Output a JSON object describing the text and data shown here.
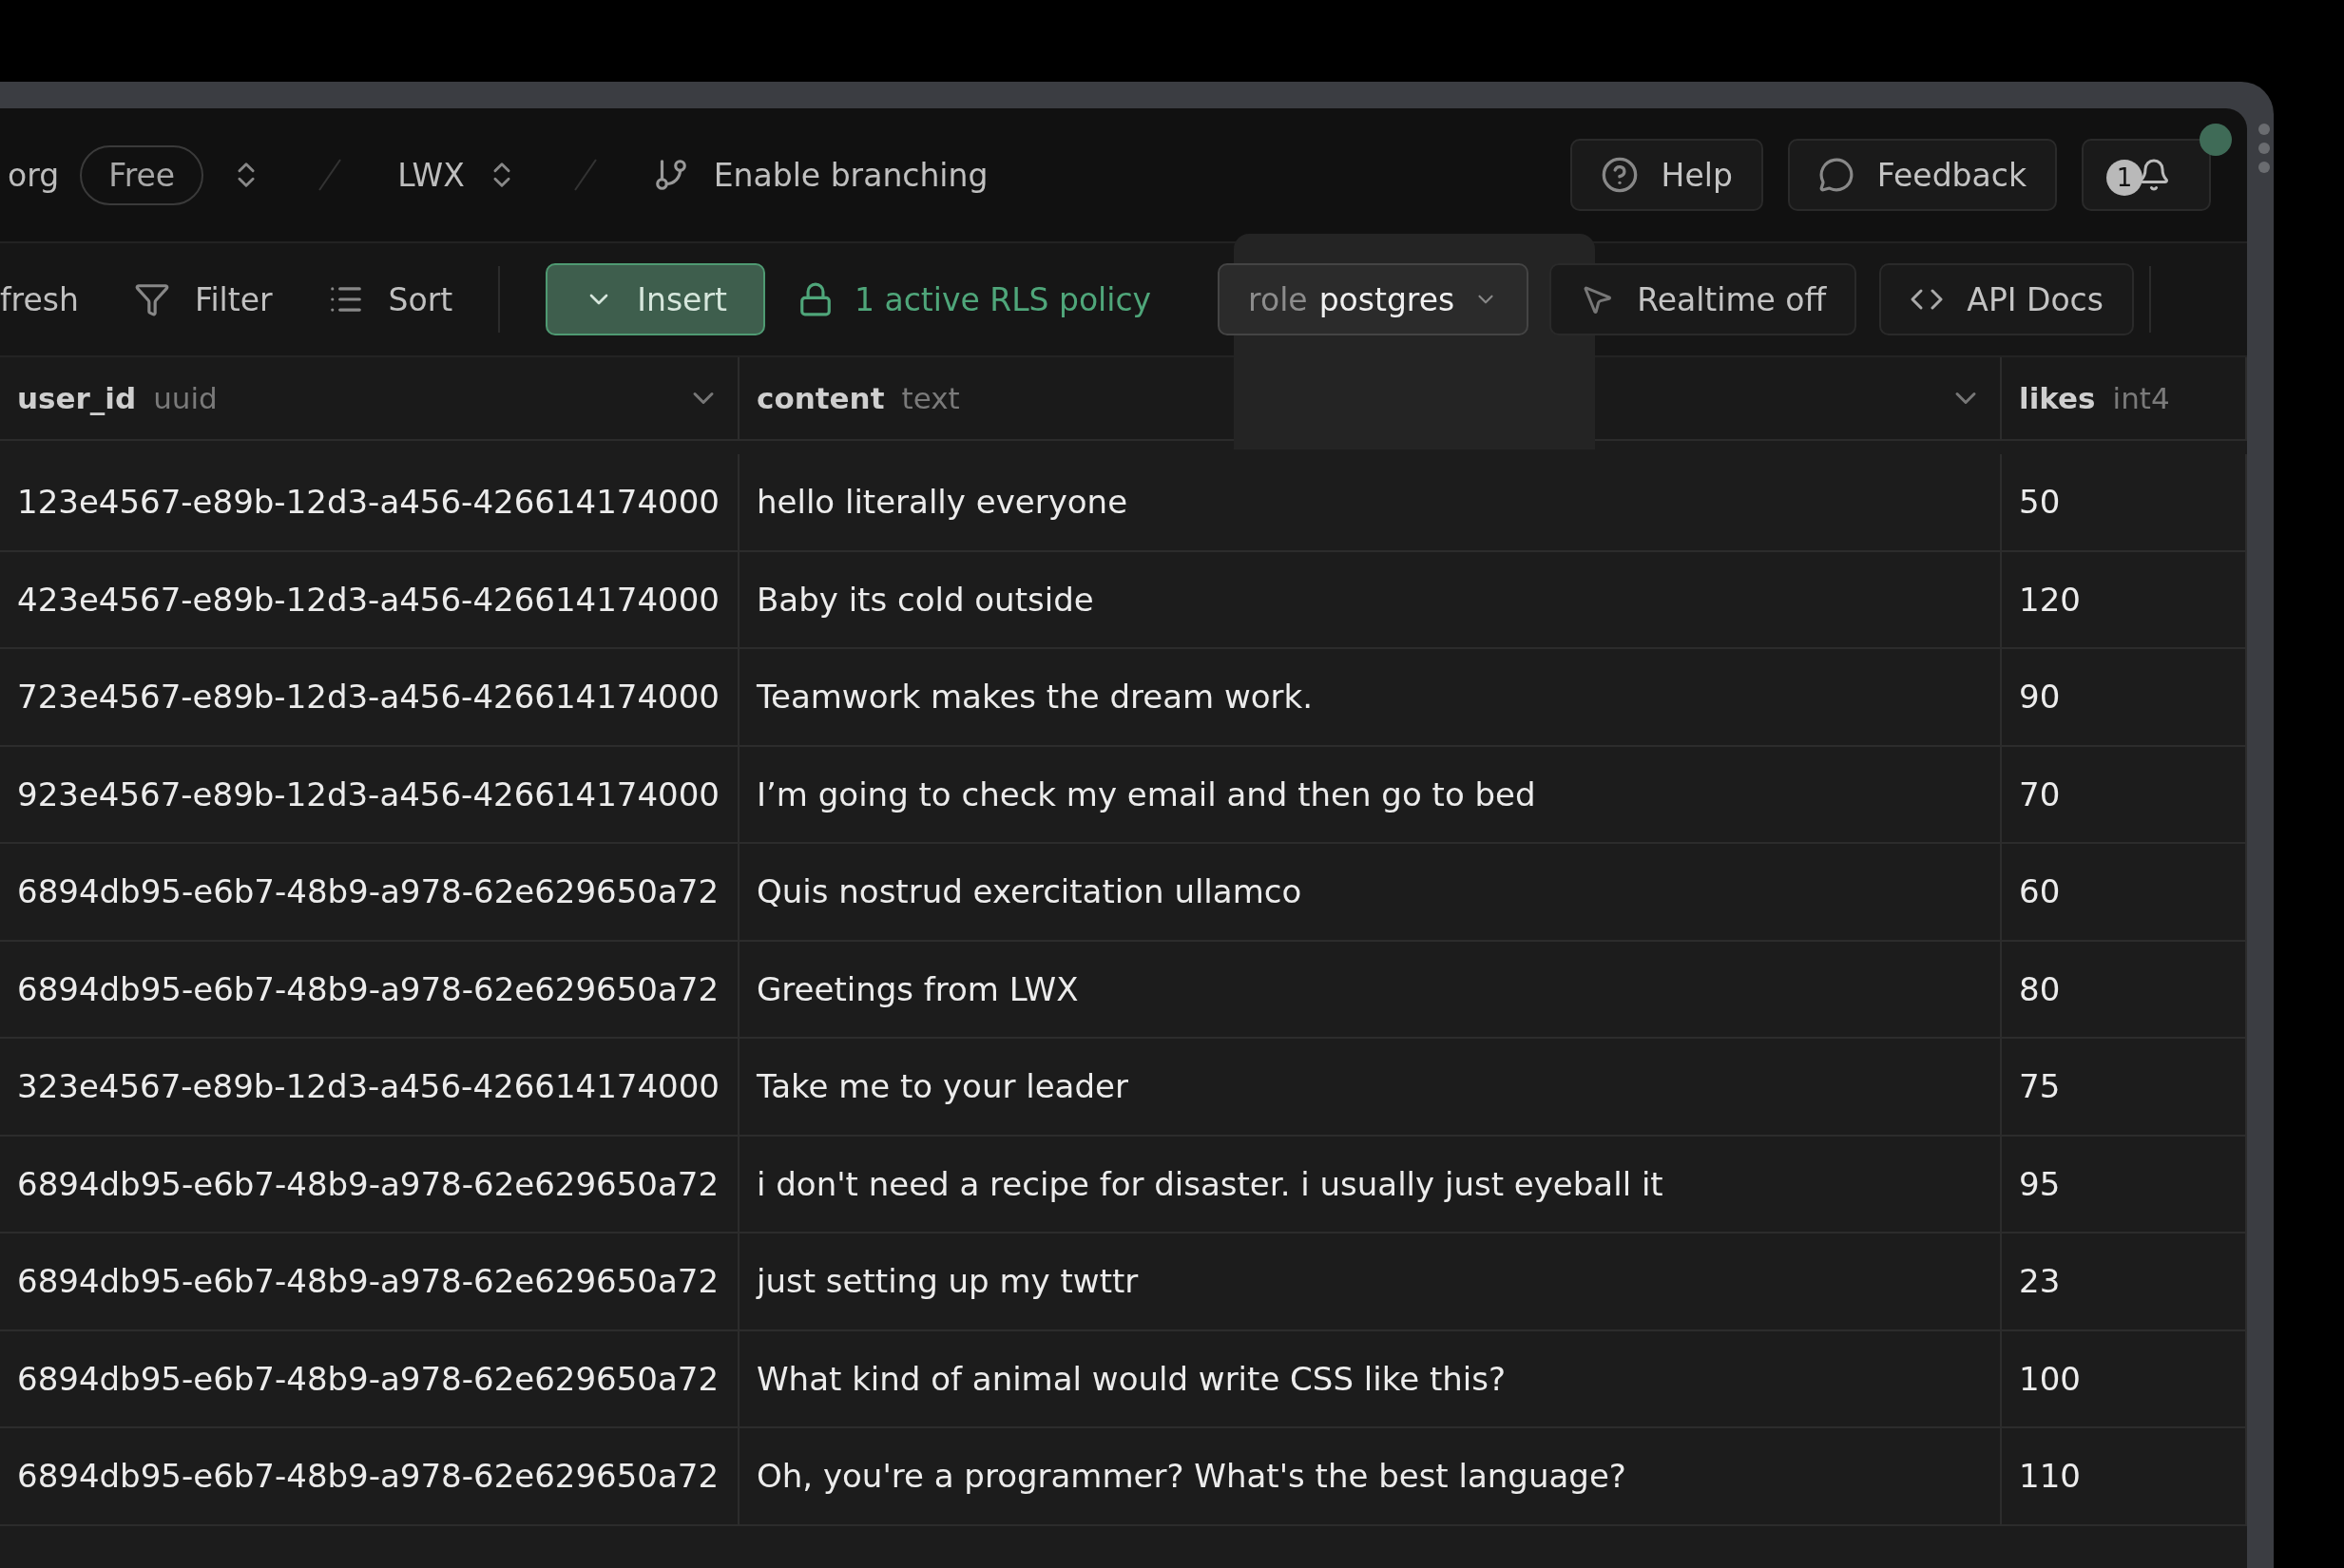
{
  "top_bar": {
    "org": "org",
    "plan": "Free",
    "project": "LWX",
    "branching": "Enable branching",
    "help": "Help",
    "feedback": "Feedback",
    "notifications": "1",
    "online": true
  },
  "toolbar": {
    "refresh": "fresh",
    "filter": "Filter",
    "sort": "Sort",
    "insert": "Insert",
    "rls_policy": "1 active RLS policy",
    "role_label": "role",
    "role": "postgres",
    "role_menu_open": true,
    "realtime": "Realtime off",
    "api_docs": "API Docs"
  },
  "table": {
    "columns": [
      {
        "name": "user_id",
        "type": "uuid",
        "menu": true
      },
      {
        "name": "content",
        "type": "text",
        "menu": true
      },
      {
        "name": "likes",
        "type": "int4",
        "menu": false
      }
    ],
    "rows": [
      [
        "123e4567-e89b-12d3-a456-426614174000",
        "hello literally everyone",
        "50"
      ],
      [
        "423e4567-e89b-12d3-a456-426614174000",
        "Baby its cold outside",
        "120"
      ],
      [
        "723e4567-e89b-12d3-a456-426614174000",
        "Teamwork makes the dream work.",
        "90"
      ],
      [
        "923e4567-e89b-12d3-a456-426614174000",
        "I’m going to check my email and then go to bed",
        "70"
      ],
      [
        "6894db95-e6b7-48b9-a978-62e629650a72",
        "Quis nostrud exercitation ullamco",
        "60"
      ],
      [
        "6894db95-e6b7-48b9-a978-62e629650a72",
        "Greetings from LWX",
        "80"
      ],
      [
        "323e4567-e89b-12d3-a456-426614174000",
        "Take me to your leader",
        "75"
      ],
      [
        "6894db95-e6b7-48b9-a978-62e629650a72",
        "i don't need a recipe for disaster. i usually just eyeball it",
        "95"
      ],
      [
        "6894db95-e6b7-48b9-a978-62e629650a72",
        "just setting up my twttr",
        "23"
      ],
      [
        "6894db95-e6b7-48b9-a978-62e629650a72",
        "What kind of animal would write CSS like this?",
        "100"
      ],
      [
        "6894db95-e6b7-48b9-a978-62e629650a72",
        "Oh, you're a programmer? What's the best language?",
        "110"
      ]
    ]
  }
}
